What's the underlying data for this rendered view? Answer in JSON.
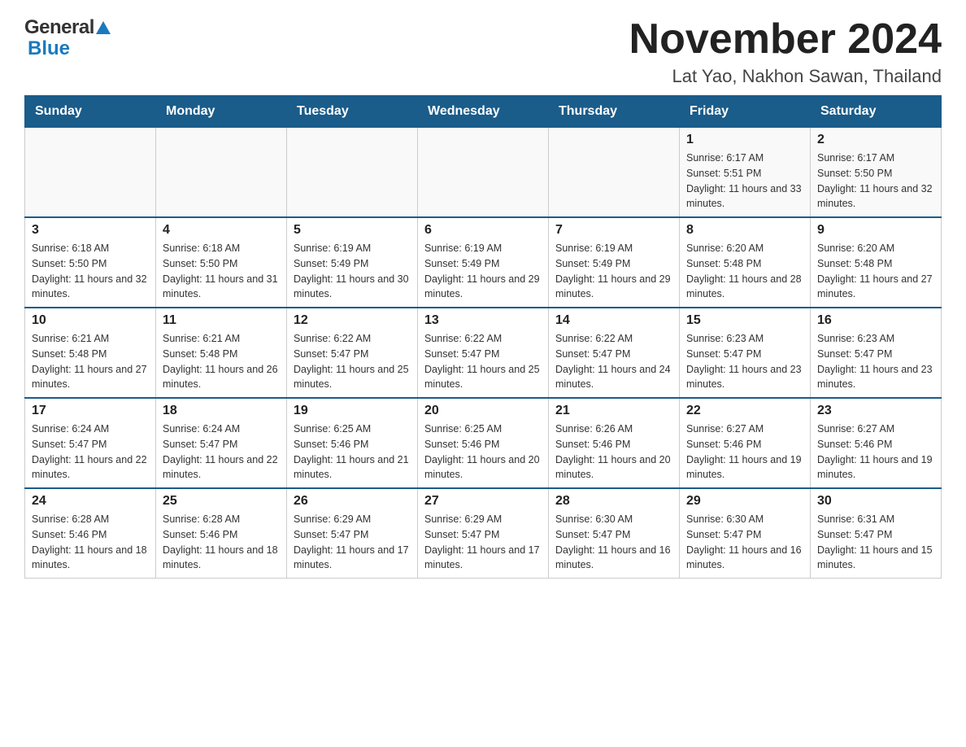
{
  "header": {
    "logo_general": "General",
    "logo_blue": "Blue",
    "title": "November 2024",
    "subtitle": "Lat Yao, Nakhon Sawan, Thailand"
  },
  "days_of_week": [
    "Sunday",
    "Monday",
    "Tuesday",
    "Wednesday",
    "Thursday",
    "Friday",
    "Saturday"
  ],
  "weeks": [
    [
      {
        "day": "",
        "info": ""
      },
      {
        "day": "",
        "info": ""
      },
      {
        "day": "",
        "info": ""
      },
      {
        "day": "",
        "info": ""
      },
      {
        "day": "",
        "info": ""
      },
      {
        "day": "1",
        "info": "Sunrise: 6:17 AM\nSunset: 5:51 PM\nDaylight: 11 hours and 33 minutes."
      },
      {
        "day": "2",
        "info": "Sunrise: 6:17 AM\nSunset: 5:50 PM\nDaylight: 11 hours and 32 minutes."
      }
    ],
    [
      {
        "day": "3",
        "info": "Sunrise: 6:18 AM\nSunset: 5:50 PM\nDaylight: 11 hours and 32 minutes."
      },
      {
        "day": "4",
        "info": "Sunrise: 6:18 AM\nSunset: 5:50 PM\nDaylight: 11 hours and 31 minutes."
      },
      {
        "day": "5",
        "info": "Sunrise: 6:19 AM\nSunset: 5:49 PM\nDaylight: 11 hours and 30 minutes."
      },
      {
        "day": "6",
        "info": "Sunrise: 6:19 AM\nSunset: 5:49 PM\nDaylight: 11 hours and 29 minutes."
      },
      {
        "day": "7",
        "info": "Sunrise: 6:19 AM\nSunset: 5:49 PM\nDaylight: 11 hours and 29 minutes."
      },
      {
        "day": "8",
        "info": "Sunrise: 6:20 AM\nSunset: 5:48 PM\nDaylight: 11 hours and 28 minutes."
      },
      {
        "day": "9",
        "info": "Sunrise: 6:20 AM\nSunset: 5:48 PM\nDaylight: 11 hours and 27 minutes."
      }
    ],
    [
      {
        "day": "10",
        "info": "Sunrise: 6:21 AM\nSunset: 5:48 PM\nDaylight: 11 hours and 27 minutes."
      },
      {
        "day": "11",
        "info": "Sunrise: 6:21 AM\nSunset: 5:48 PM\nDaylight: 11 hours and 26 minutes."
      },
      {
        "day": "12",
        "info": "Sunrise: 6:22 AM\nSunset: 5:47 PM\nDaylight: 11 hours and 25 minutes."
      },
      {
        "day": "13",
        "info": "Sunrise: 6:22 AM\nSunset: 5:47 PM\nDaylight: 11 hours and 25 minutes."
      },
      {
        "day": "14",
        "info": "Sunrise: 6:22 AM\nSunset: 5:47 PM\nDaylight: 11 hours and 24 minutes."
      },
      {
        "day": "15",
        "info": "Sunrise: 6:23 AM\nSunset: 5:47 PM\nDaylight: 11 hours and 23 minutes."
      },
      {
        "day": "16",
        "info": "Sunrise: 6:23 AM\nSunset: 5:47 PM\nDaylight: 11 hours and 23 minutes."
      }
    ],
    [
      {
        "day": "17",
        "info": "Sunrise: 6:24 AM\nSunset: 5:47 PM\nDaylight: 11 hours and 22 minutes."
      },
      {
        "day": "18",
        "info": "Sunrise: 6:24 AM\nSunset: 5:47 PM\nDaylight: 11 hours and 22 minutes."
      },
      {
        "day": "19",
        "info": "Sunrise: 6:25 AM\nSunset: 5:46 PM\nDaylight: 11 hours and 21 minutes."
      },
      {
        "day": "20",
        "info": "Sunrise: 6:25 AM\nSunset: 5:46 PM\nDaylight: 11 hours and 20 minutes."
      },
      {
        "day": "21",
        "info": "Sunrise: 6:26 AM\nSunset: 5:46 PM\nDaylight: 11 hours and 20 minutes."
      },
      {
        "day": "22",
        "info": "Sunrise: 6:27 AM\nSunset: 5:46 PM\nDaylight: 11 hours and 19 minutes."
      },
      {
        "day": "23",
        "info": "Sunrise: 6:27 AM\nSunset: 5:46 PM\nDaylight: 11 hours and 19 minutes."
      }
    ],
    [
      {
        "day": "24",
        "info": "Sunrise: 6:28 AM\nSunset: 5:46 PM\nDaylight: 11 hours and 18 minutes."
      },
      {
        "day": "25",
        "info": "Sunrise: 6:28 AM\nSunset: 5:46 PM\nDaylight: 11 hours and 18 minutes."
      },
      {
        "day": "26",
        "info": "Sunrise: 6:29 AM\nSunset: 5:47 PM\nDaylight: 11 hours and 17 minutes."
      },
      {
        "day": "27",
        "info": "Sunrise: 6:29 AM\nSunset: 5:47 PM\nDaylight: 11 hours and 17 minutes."
      },
      {
        "day": "28",
        "info": "Sunrise: 6:30 AM\nSunset: 5:47 PM\nDaylight: 11 hours and 16 minutes."
      },
      {
        "day": "29",
        "info": "Sunrise: 6:30 AM\nSunset: 5:47 PM\nDaylight: 11 hours and 16 minutes."
      },
      {
        "day": "30",
        "info": "Sunrise: 6:31 AM\nSunset: 5:47 PM\nDaylight: 11 hours and 15 minutes."
      }
    ]
  ]
}
